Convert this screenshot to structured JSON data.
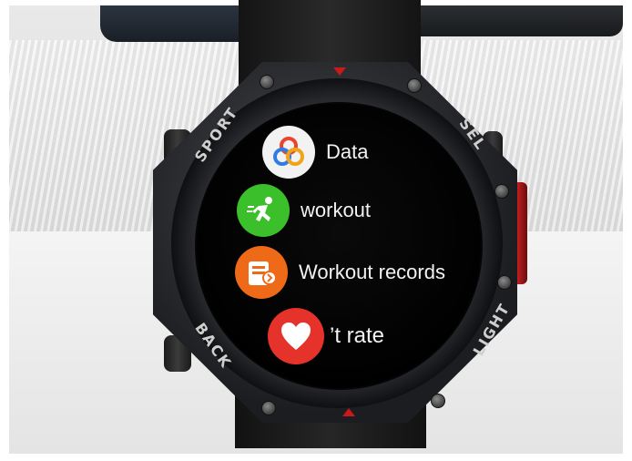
{
  "watch": {
    "bezel_labels": {
      "top_left": "SPORT",
      "top_right": "SEL",
      "bottom_left": "BACK",
      "bottom_right": "LIGHT"
    },
    "menu": [
      {
        "label": "Data",
        "icon": "data-circles-icon",
        "color": "#f2f2f2"
      },
      {
        "label": "workout",
        "icon": "running-person-icon",
        "color": "#3bbf2a"
      },
      {
        "label": "Workout records",
        "icon": "records-document-icon",
        "color": "#ef6a18"
      },
      {
        "label": "’t rate",
        "icon": "heart-icon",
        "color": "#e5322a"
      }
    ]
  }
}
